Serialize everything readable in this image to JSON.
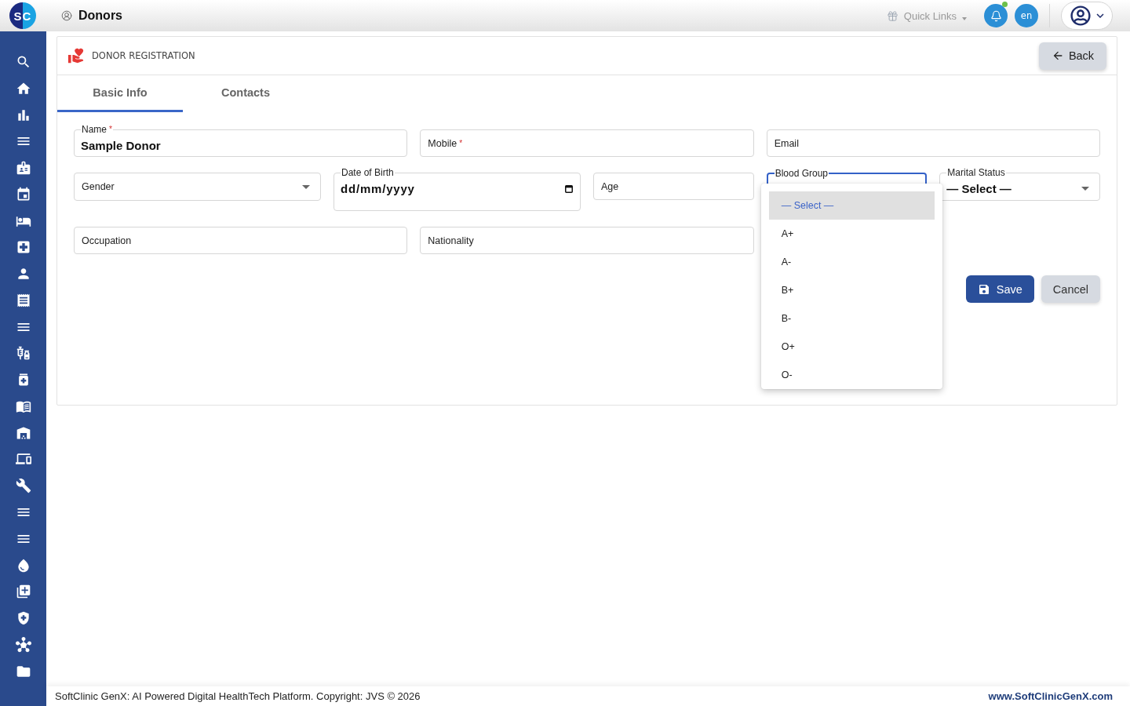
{
  "header": {
    "logo": {
      "left": "S",
      "right": "C"
    },
    "title": "Donors",
    "quick_links": "Quick Links",
    "notifications": {
      "unread": true
    },
    "language": "en"
  },
  "card": {
    "title": "DONOR REGISTRATION",
    "back_button": "Back",
    "tabs": [
      {
        "label": "Basic Info",
        "selected": true
      },
      {
        "label": "Contacts",
        "selected": false
      }
    ],
    "form": {
      "fields": [
        {
          "kind": "text",
          "label": "Name",
          "required_mark": "*",
          "value": "Sample Donor"
        },
        {
          "kind": "text",
          "label": "Mobile",
          "required_mark": "*"
        },
        {
          "kind": "text",
          "label": "Email"
        },
        {
          "kind": "select",
          "label": "Gender",
          "expanded": false
        },
        {
          "kind": "date",
          "label": "Date of Birth",
          "placeholder": "dd/mm/yyyy"
        },
        {
          "kind": "text",
          "label": "Age"
        },
        {
          "kind": "select",
          "label": "Blood Group",
          "expanded": true,
          "options": [
            {
              "label": "— Select —",
              "selected": true
            },
            {
              "label": "A+",
              "selected": false
            },
            {
              "label": "A-",
              "selected": false
            },
            {
              "label": "B+",
              "selected": false
            },
            {
              "label": "B-",
              "selected": false
            },
            {
              "label": "O+",
              "selected": false
            },
            {
              "label": "O-",
              "selected": false
            }
          ]
        },
        {
          "kind": "select",
          "label": "Marital Status",
          "expanded": false,
          "value": "— Select —"
        },
        {
          "kind": "text",
          "label": "Occupation"
        },
        {
          "kind": "text",
          "label": "Nationality"
        }
      ]
    },
    "actions": [
      {
        "kind": "primary",
        "label": "Save"
      },
      {
        "kind": "secondary",
        "label": "Cancel"
      }
    ]
  },
  "footer": {
    "copyright": "SoftClinic GenX: AI Powered Digital HealthTech Platform. Copyright: JVS © 2026",
    "website": "www.SoftClinicGenX.com"
  }
}
